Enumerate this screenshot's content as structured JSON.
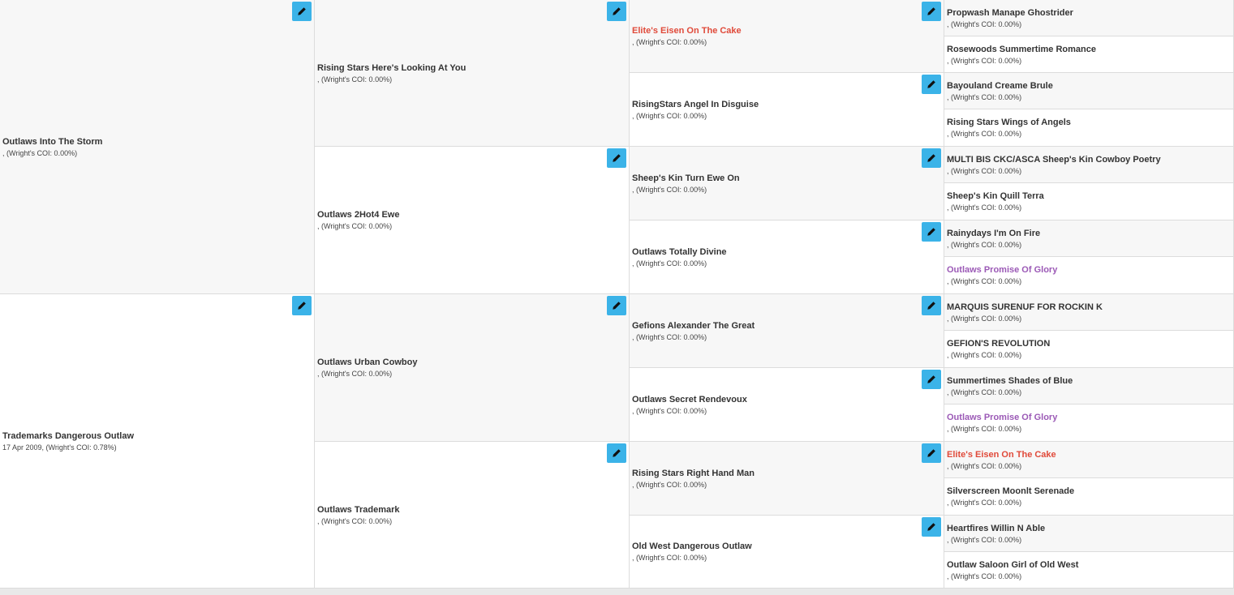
{
  "pedigree": {
    "col1": [
      {
        "name": "Outlaws Into The Storm",
        "info": ", (Wright's COI: 0.00%)"
      },
      {
        "name": "Trademarks Dangerous Outlaw",
        "info": "17 Apr 2009, (Wright's COI: 0.78%)"
      }
    ],
    "col2": [
      {
        "name": "Rising Stars Here's Looking At You",
        "info": ", (Wright's COI: 0.00%)"
      },
      {
        "name": "Outlaws 2Hot4 Ewe",
        "info": ", (Wright's COI: 0.00%)"
      },
      {
        "name": "Outlaws Urban Cowboy",
        "info": ", (Wright's COI: 0.00%)"
      },
      {
        "name": "Outlaws Trademark",
        "info": ", (Wright's COI: 0.00%)"
      }
    ],
    "col3": [
      {
        "name": "Elite's Eisen On The Cake",
        "info": ", (Wright's COI: 0.00%)"
      },
      {
        "name": "RisingStars Angel In Disguise",
        "info": ", (Wright's COI: 0.00%)"
      },
      {
        "name": "Sheep's Kin Turn Ewe On",
        "info": ", (Wright's COI: 0.00%)"
      },
      {
        "name": "Outlaws Totally Divine",
        "info": ", (Wright's COI: 0.00%)"
      },
      {
        "name": "Gefions Alexander The Great",
        "info": ", (Wright's COI: 0.00%)"
      },
      {
        "name": "Outlaws Secret Rendevoux",
        "info": ", (Wright's COI: 0.00%)"
      },
      {
        "name": "Rising Stars Right Hand Man",
        "info": ", (Wright's COI: 0.00%)"
      },
      {
        "name": "Old West Dangerous Outlaw",
        "info": ", (Wright's COI: 0.00%)"
      }
    ],
    "col4": [
      {
        "name": "Propwash Manape Ghostrider",
        "info": ", (Wright's COI: 0.00%)"
      },
      {
        "name": "Rosewoods Summertime Romance",
        "info": ", (Wright's COI: 0.00%)"
      },
      {
        "name": "Bayouland Creame Brule",
        "info": ", (Wright's COI: 0.00%)"
      },
      {
        "name": "Rising Stars Wings of Angels",
        "info": ", (Wright's COI: 0.00%)"
      },
      {
        "name": "MULTI BIS CKC/ASCA Sheep's Kin Cowboy Poetry",
        "info": ", (Wright's COI: 0.00%)"
      },
      {
        "name": "Sheep's Kin Quill Terra",
        "info": ", (Wright's COI: 0.00%)"
      },
      {
        "name": "Rainydays I'm On Fire",
        "info": ", (Wright's COI: 0.00%)"
      },
      {
        "name": "Outlaws Promise Of Glory",
        "info": ", (Wright's COI: 0.00%)"
      },
      {
        "name": "MARQUIS SURENUF FOR ROCKIN K",
        "info": ", (Wright's COI: 0.00%)"
      },
      {
        "name": "GEFION'S REVOLUTION",
        "info": ", (Wright's COI: 0.00%)"
      },
      {
        "name": "Summertimes Shades of Blue",
        "info": ", (Wright's COI: 0.00%)"
      },
      {
        "name": "Outlaws Promise Of Glory",
        "info": ", (Wright's COI: 0.00%)"
      },
      {
        "name": "Elite's Eisen On The Cake",
        "info": ", (Wright's COI: 0.00%)"
      },
      {
        "name": "Silverscreen Moonlt Serenade",
        "info": ", (Wright's COI: 0.00%)"
      },
      {
        "name": "Heartfires Willin N Able",
        "info": ", (Wright's COI: 0.00%)"
      },
      {
        "name": "Outlaw Saloon Girl of Old West",
        "info": ", (Wright's COI: 0.00%)"
      }
    ]
  },
  "colors": {
    "edit_button": "#3bb3e8",
    "duplicate_red": "#e04a3a",
    "duplicate_purple": "#9b59b6"
  },
  "icons": {
    "edit": "pencil-icon"
  }
}
